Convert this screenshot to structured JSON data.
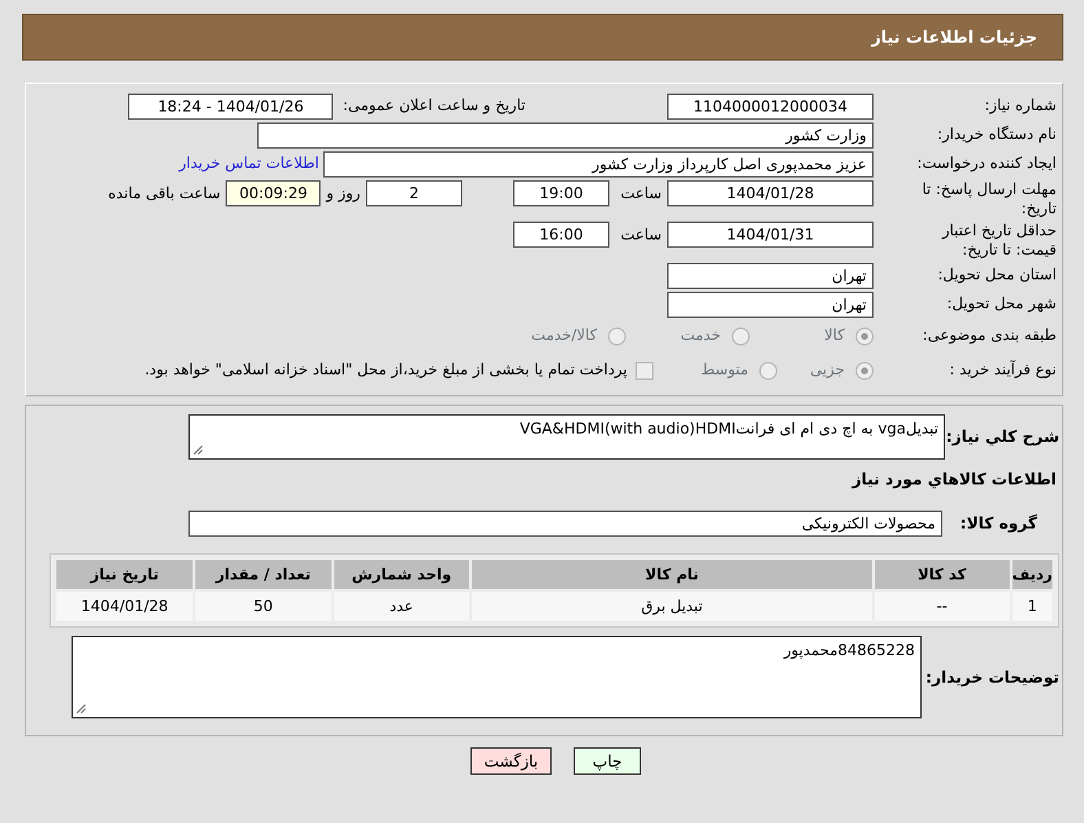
{
  "header": {
    "title": "جزئیات اطلاعات نیاز"
  },
  "need_number": {
    "label": "شماره نیاز:",
    "value": "1104000012000034"
  },
  "announce": {
    "label": "تاریخ و ساعت اعلان عمومی:",
    "value": "1404/01/26 - 18:24"
  },
  "buyer_org": {
    "label": "نام دستگاه خریدار:",
    "value": "وزارت کشور"
  },
  "requester": {
    "label": "ایجاد کننده درخواست:",
    "value": "عزیز محمدپوری اصل کارپرداز وزارت کشور",
    "link": "اطلاعات تماس خریدار"
  },
  "deadline": {
    "label": "مهلت ارسال پاسخ: تا تاریخ:",
    "date": "1404/01/28",
    "time_label": "ساعت",
    "time": "19:00",
    "days": "2",
    "days_label": "روز و",
    "remaining": "00:09:29",
    "remaining_label": "ساعت باقی مانده"
  },
  "validity": {
    "label": "حداقل تاریخ اعتبار قیمت: تا تاریخ:",
    "date": "1404/01/31",
    "time_label": "ساعت",
    "time": "16:00"
  },
  "province": {
    "label": "استان محل تحویل:",
    "value": "تهران"
  },
  "city": {
    "label": "شهر محل تحویل:",
    "value": "تهران"
  },
  "category": {
    "label": "طبقه بندی موضوعی:",
    "options": [
      {
        "label": "کالا",
        "selected": true
      },
      {
        "label": "خدمت",
        "selected": false
      },
      {
        "label": "کالا/خدمت",
        "selected": false
      }
    ]
  },
  "process": {
    "label": "نوع فرآیند خرید :",
    "options": [
      {
        "label": "جزیی",
        "selected": true
      },
      {
        "label": "متوسط",
        "selected": false
      }
    ],
    "treasury": {
      "label": "پرداخت تمام یا بخشی از مبلغ خرید،از محل \"اسناد خزانه اسلامی\" خواهد بود.",
      "checked": false
    }
  },
  "description": {
    "label": "شرح کلي نياز:",
    "value": "تبدیلvga به اچ دی ام ای فرانتVGA&HDMI(with audio)HDMI"
  },
  "goods_title": "اطلاعات كالاهاي مورد نياز",
  "goods_group": {
    "label": "گروه کالا:",
    "value": "محصولات الکترونیکی"
  },
  "table": {
    "columns": [
      "ردیف",
      "کد کالا",
      "نام کالا",
      "واحد شمارش",
      "تعداد / مقدار",
      "تاریخ نیاز"
    ],
    "rows": [
      [
        "1",
        "--",
        "تبدیل برق",
        "عدد",
        "50",
        "1404/01/28"
      ]
    ]
  },
  "buyer_notes": {
    "label": "توضیحات خریدار:",
    "value": "84865228محمدپور"
  },
  "buttons": [
    {
      "label": "چاپ",
      "kind": "print"
    },
    {
      "label": "بازگشت",
      "kind": "back"
    }
  ]
}
